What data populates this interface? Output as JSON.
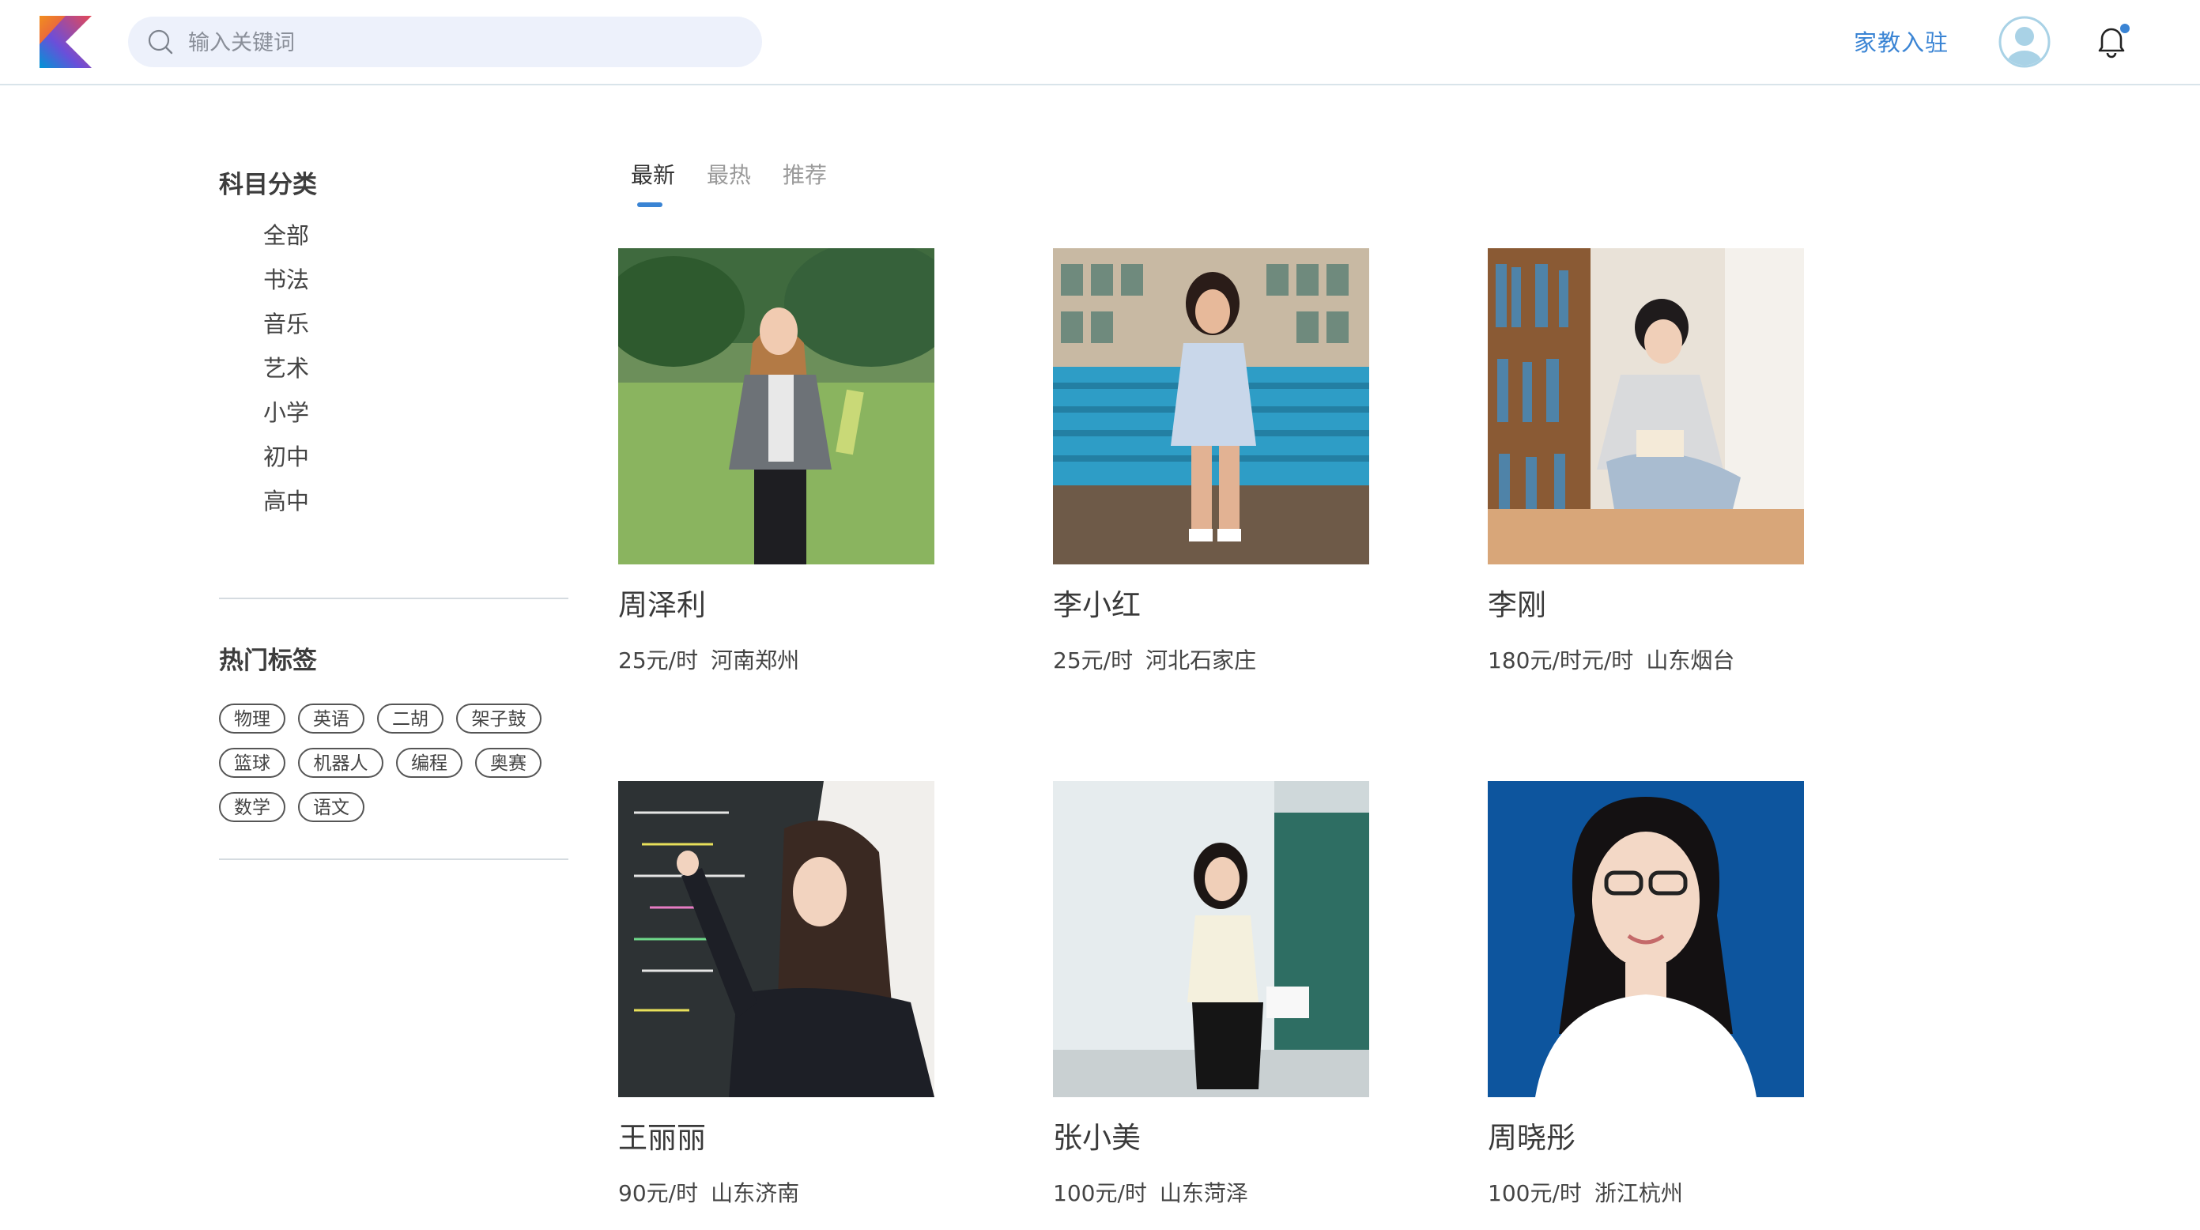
{
  "header": {
    "search_placeholder": "输入关键词",
    "join_label": "家教入驻"
  },
  "sidebar": {
    "subject_title": "科目分类",
    "subjects": [
      "全部",
      "书法",
      "音乐",
      "艺术",
      "小学",
      "初中",
      "高中"
    ],
    "tags_title": "热门标签",
    "tags": [
      "物理",
      "英语",
      "二胡",
      "架子鼓",
      "篮球",
      "机器人",
      "编程",
      "奥赛",
      "数学",
      "语文"
    ]
  },
  "tabs": [
    {
      "label": "最新",
      "active": true
    },
    {
      "label": "最热",
      "active": false
    },
    {
      "label": "推荐",
      "active": false
    }
  ],
  "tutors": [
    {
      "name": "周泽利",
      "price": "25元/时",
      "location": "河南郑州",
      "photo": "student-on-lawn-photo"
    },
    {
      "name": "李小红",
      "price": "25元/时",
      "location": "河北石家庄",
      "photo": "girl-on-bench-photo"
    },
    {
      "name": "李刚",
      "price": "180元/时元/时",
      "location": "山东烟台",
      "photo": "boy-reading-photo"
    },
    {
      "name": "王丽丽",
      "price": "90元/时",
      "location": "山东济南",
      "photo": "teacher-at-blackboard-photo"
    },
    {
      "name": "张小美",
      "price": "100元/时",
      "location": "山东菏泽",
      "photo": "teacher-in-classroom-photo"
    },
    {
      "name": "周晓彤",
      "price": "100元/时",
      "location": "浙江杭州",
      "photo": "portrait-blue-bg-photo"
    }
  ],
  "colors": {
    "accent": "#3a84d4",
    "search_bg": "#edf1fb",
    "notification_dot": "#3a84d4"
  }
}
